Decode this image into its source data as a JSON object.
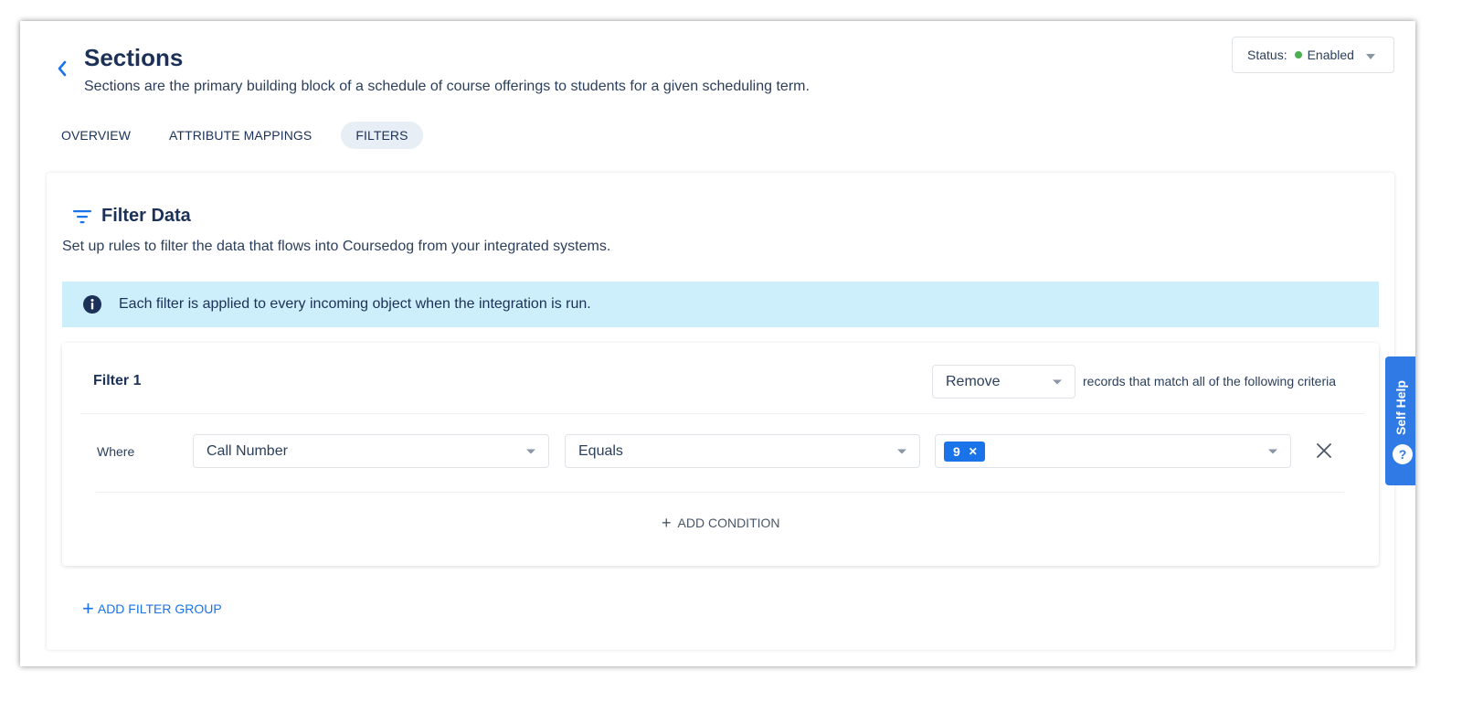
{
  "header": {
    "title": "Sections",
    "subtitle": "Sections are the primary building block of a schedule of course offerings to students for a given scheduling term.",
    "back_icon": "chevron-left-icon"
  },
  "status": {
    "label": "Status:",
    "value": "Enabled",
    "color": "#4caf50"
  },
  "tabs": [
    {
      "label": "OVERVIEW",
      "active": false
    },
    {
      "label": "ATTRIBUTE MAPPINGS",
      "active": false
    },
    {
      "label": "FILTERS",
      "active": true
    }
  ],
  "filter_panel": {
    "icon": "filter-icon",
    "title": "Filter Data",
    "description": "Set up rules to filter the data that flows into Coursedog from your integrated systems.",
    "info_text": "Each filter is applied to every incoming object when the integration is run.",
    "info_bg": "#cdeefb"
  },
  "filter_group": {
    "title": "Filter 1",
    "action": "Remove",
    "criteria_text": "records that match all of the following criteria",
    "condition": {
      "where_label": "Where",
      "field": "Call Number",
      "operator": "Equals",
      "values": [
        "9"
      ]
    },
    "add_condition_label": "ADD CONDITION"
  },
  "add_filter_group_label": "ADD FILTER GROUP",
  "self_help": {
    "label": "Self Help",
    "icon": "question-chat-icon"
  },
  "colors": {
    "primary_text": "#1b3157",
    "accent": "#1a73e8",
    "self_help_bg": "#2f7ae5"
  }
}
